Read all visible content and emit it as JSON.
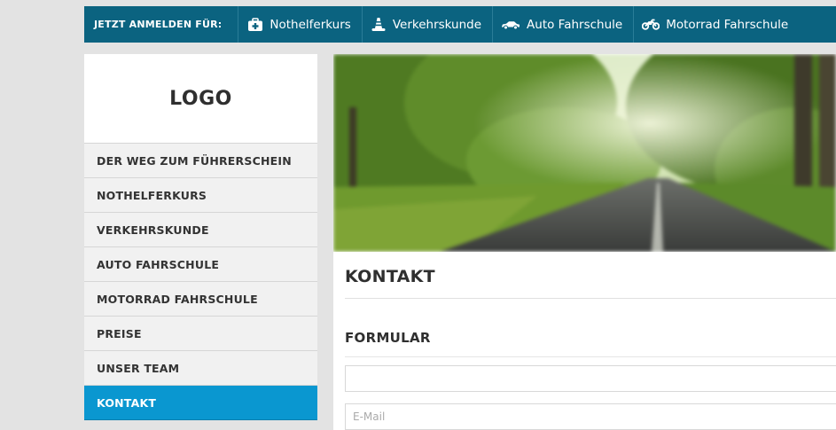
{
  "topbar": {
    "lead": "JETZT ANMELDEN FÜR:",
    "items": [
      {
        "label": "Nothelferkurs",
        "icon": "first-aid-kit-icon"
      },
      {
        "label": "Verkehrskunde",
        "icon": "traffic-cone-icon"
      },
      {
        "label": "Auto Fahrschule",
        "icon": "car-icon"
      },
      {
        "label": "Motorrad Fahrschule",
        "icon": "motorcycle-icon"
      }
    ],
    "colors": {
      "background": "#0b6380",
      "text": "#ffffff"
    }
  },
  "sidebar": {
    "logo": "LOGO",
    "items": [
      {
        "label": "DER WEG ZUM FÜHRERSCHEIN"
      },
      {
        "label": "NOTHELFERKURS"
      },
      {
        "label": "VERKEHRSKUNDE"
      },
      {
        "label": "AUTO FAHRSCHULE"
      },
      {
        "label": "MOTORRAD FAHRSCHULE"
      },
      {
        "label": "PREISE"
      },
      {
        "label": "UNSER TEAM"
      },
      {
        "label": "KONTAKT"
      }
    ],
    "active_index": 7,
    "colors": {
      "active": "#0a97d0",
      "item_bg": "#f1f1f1"
    }
  },
  "main": {
    "hero": {
      "description_icon": "road-through-trees-image"
    },
    "title": "KONTAKT",
    "form": {
      "heading": "FORMULAR",
      "name_placeholder": "",
      "email_placeholder": "E-Mail"
    }
  }
}
